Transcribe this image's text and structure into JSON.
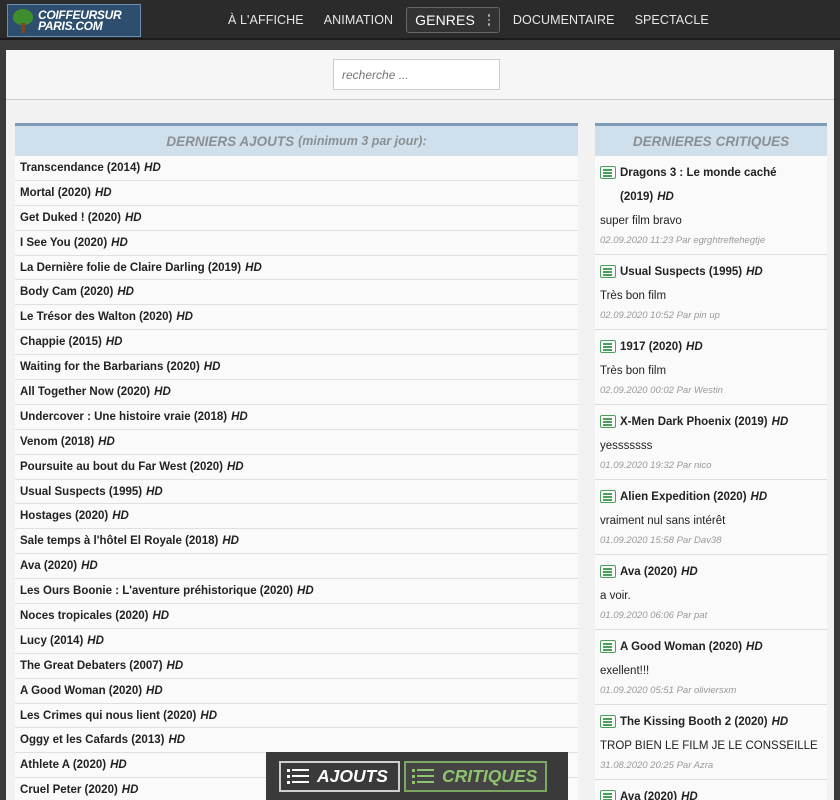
{
  "logo": {
    "line1": "COIFFEURSUR",
    "line2": "PARIS.COM"
  },
  "nav": [
    {
      "label": "À L'AFFICHE"
    },
    {
      "label": "ANIMATION"
    },
    {
      "label": "GENRES"
    },
    {
      "label": "DOCUMENTAIRE"
    },
    {
      "label": "SPECTACLE"
    }
  ],
  "search": {
    "placeholder": "recherche ..."
  },
  "left_panel": {
    "title": "DERNIERS AJOUTS",
    "subtitle": "(minimum 3 par jour):",
    "items": [
      {
        "title": "Transcendance (2014)",
        "badge": "HD"
      },
      {
        "title": "Mortal (2020)",
        "badge": "HD"
      },
      {
        "title": "Get Duked ! (2020)",
        "badge": "HD"
      },
      {
        "title": "I See You (2020)",
        "badge": "HD"
      },
      {
        "title": "La Dernière folie de Claire Darling (2019)",
        "badge": "HD"
      },
      {
        "title": "Body Cam (2020)",
        "badge": "HD"
      },
      {
        "title": "Le Trésor des Walton (2020)",
        "badge": "HD"
      },
      {
        "title": "Chappie (2015)",
        "badge": "HD"
      },
      {
        "title": "Waiting for the Barbarians (2020)",
        "badge": "HD"
      },
      {
        "title": "All Together Now (2020)",
        "badge": "HD"
      },
      {
        "title": "Undercover : Une histoire vraie (2018)",
        "badge": "HD"
      },
      {
        "title": "Venom (2018)",
        "badge": "HD"
      },
      {
        "title": "Poursuite au bout du Far West (2020)",
        "badge": "HD"
      },
      {
        "title": "Usual Suspects (1995)",
        "badge": "HD"
      },
      {
        "title": "Hostages (2020)",
        "badge": "HD"
      },
      {
        "title": "Sale temps à l'hôtel El Royale (2018)",
        "badge": "HD"
      },
      {
        "title": "Ava (2020)",
        "badge": "HD"
      },
      {
        "title": "Les Ours Boonie : L'aventure préhistorique (2020)",
        "badge": "HD"
      },
      {
        "title": "Noces tropicales (2020)",
        "badge": "HD"
      },
      {
        "title": "Lucy (2014)",
        "badge": "HD"
      },
      {
        "title": "The Great Debaters (2007)",
        "badge": "HD"
      },
      {
        "title": "A Good Woman (2020)",
        "badge": "HD"
      },
      {
        "title": "Les Crimes qui nous lient (2020)",
        "badge": "HD"
      },
      {
        "title": "Oggy et les Cafards (2013)",
        "badge": "HD"
      },
      {
        "title": "Athlete A (2020)",
        "badge": "HD"
      },
      {
        "title": "Cruel Peter (2020)",
        "badge": "HD"
      }
    ]
  },
  "right_panel": {
    "title_a": "DERNIERES",
    "title_b": "CRITIQUES",
    "reviews": [
      {
        "title": "Dragons 3 : Le monde caché (2019)",
        "badge": "HD",
        "comment": "super film bravo",
        "meta": "02.09.2020 11:23 Par egrghtreftehegtje"
      },
      {
        "title": "Usual Suspects (1995)",
        "badge": "HD",
        "comment": "Très bon film",
        "meta": "02.09.2020 10:52 Par pin up"
      },
      {
        "title": "1917 (2020)",
        "badge": "HD",
        "comment": "Très bon film",
        "meta": "02.09.2020 00:02 Par Westin"
      },
      {
        "title": "X-Men Dark Phoenix (2019)",
        "badge": "HD",
        "comment": "yesssssss",
        "meta": "01.09.2020 19:32 Par nico"
      },
      {
        "title": "Alien Expedition (2020)",
        "badge": "HD",
        "comment": "vraiment nul sans intérêt",
        "meta": "01.09.2020 15:58 Par Dav38"
      },
      {
        "title": "Ava (2020)",
        "badge": "HD",
        "comment": "a voir.",
        "meta": "01.09.2020 06:06 Par pat"
      },
      {
        "title": "A Good Woman (2020)",
        "badge": "HD",
        "comment": "exellent!!!",
        "meta": "01.09.2020 05:51 Par oliviersxm"
      },
      {
        "title": "The Kissing Booth 2 (2020)",
        "badge": "HD",
        "comment": "TROP BIEN LE FILM JE LE CONSSEILLE",
        "meta": "31.08.2020 20:25 Par Azra"
      },
      {
        "title": "Ava (2020)",
        "badge": "HD",
        "comment": "",
        "meta": ""
      }
    ]
  },
  "bottom_bar": {
    "ajouts": "AJOUTS",
    "critiques": "CRITIQUES"
  }
}
